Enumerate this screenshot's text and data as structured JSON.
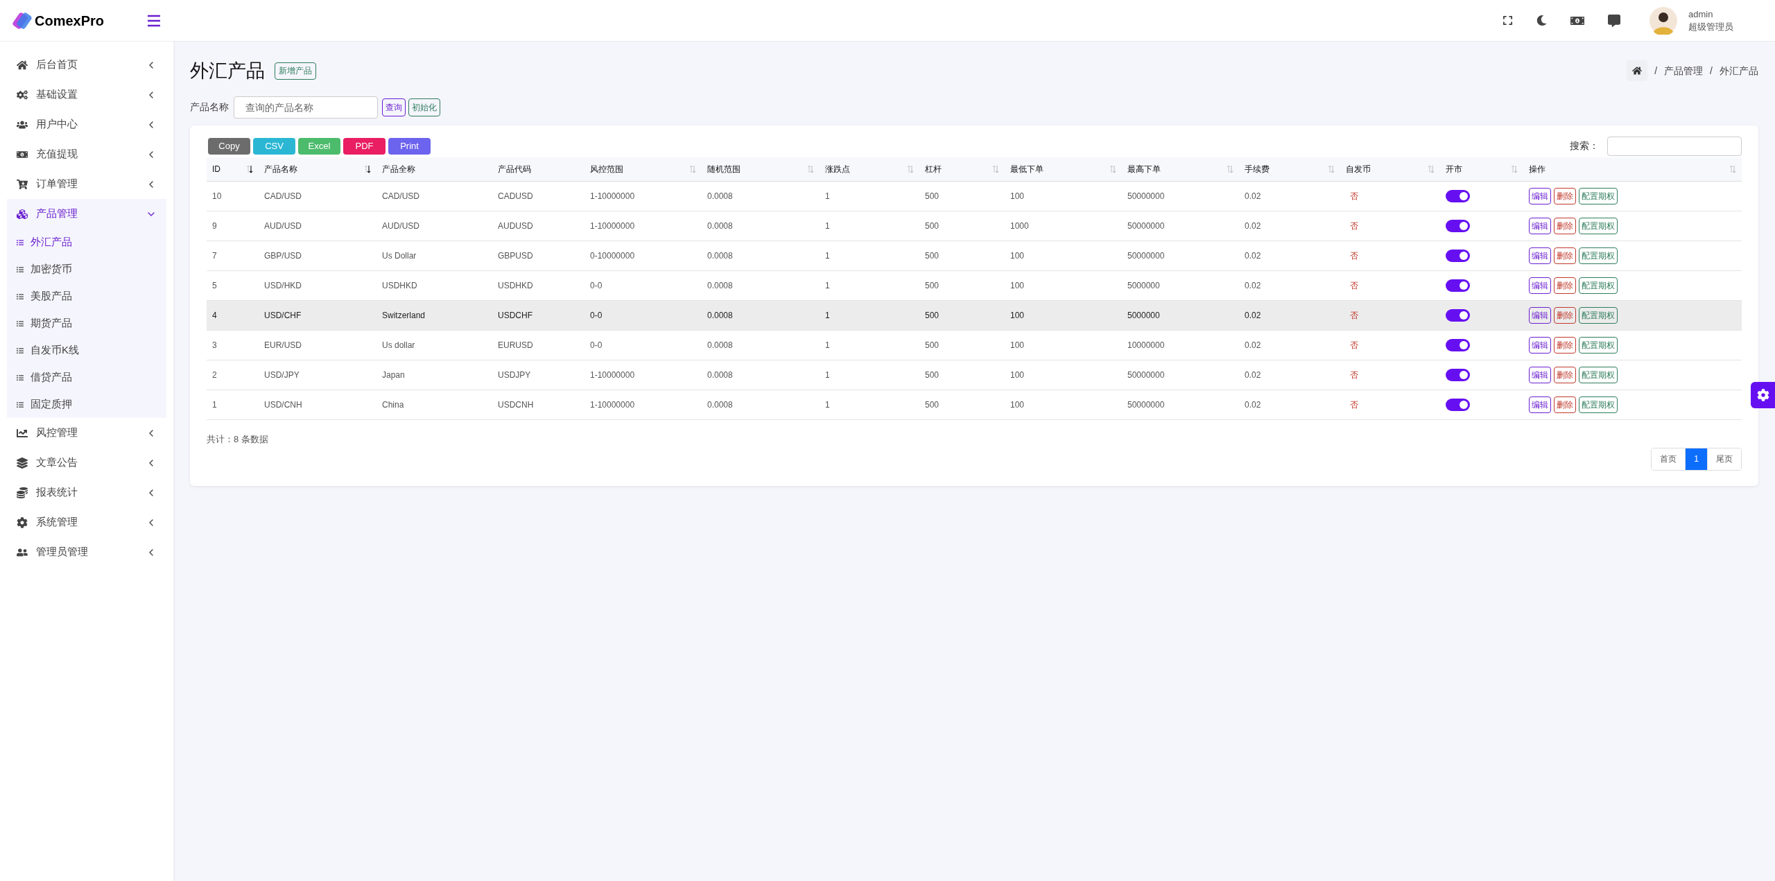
{
  "brand": {
    "name": "ComexPro"
  },
  "sidebar": {
    "items": [
      {
        "label": "后台首页",
        "expanded": false
      },
      {
        "label": "基础设置",
        "expanded": false
      },
      {
        "label": "用户中心",
        "expanded": false
      },
      {
        "label": "充值提现",
        "expanded": false
      },
      {
        "label": "订单管理",
        "expanded": false
      },
      {
        "label": "产品管理",
        "expanded": true,
        "children": [
          {
            "label": "外汇产品",
            "selected": true
          },
          {
            "label": "加密货币",
            "selected": false
          },
          {
            "label": "美股产品",
            "selected": false
          },
          {
            "label": "期货产品",
            "selected": false
          },
          {
            "label": "自发币K线",
            "selected": false
          },
          {
            "label": "借贷产品",
            "selected": false
          },
          {
            "label": "固定质押",
            "selected": false
          }
        ]
      },
      {
        "label": "风控管理",
        "expanded": false
      },
      {
        "label": "文章公告",
        "expanded": false
      },
      {
        "label": "报表统计",
        "expanded": false
      },
      {
        "label": "系统管理",
        "expanded": false
      },
      {
        "label": "管理员管理",
        "expanded": false
      }
    ]
  },
  "user": {
    "name": "admin",
    "role": "超级管理员"
  },
  "page": {
    "title": "外汇产品",
    "add_button": "新增产品",
    "breadcrumb": [
      {
        "separator": "/",
        "label": "产品管理"
      },
      {
        "separator": "/",
        "label": "外汇产品"
      }
    ]
  },
  "filter": {
    "label": "产品名称",
    "placeholder": "查询的产品名称",
    "search_button": "查询",
    "reset_button": "初始化"
  },
  "export_buttons": [
    {
      "label": "Copy",
      "color": "#6c6c6c"
    },
    {
      "label": "CSV",
      "color": "#2bb7d4"
    },
    {
      "label": "Excel",
      "color": "#4cbb6c"
    },
    {
      "label": "PDF",
      "color": "#e91e63"
    },
    {
      "label": "Print",
      "color": "#6c63ee"
    }
  ],
  "search": {
    "label": "搜索："
  },
  "table": {
    "columns": [
      {
        "label": "ID",
        "kind": "sorted"
      },
      {
        "label": "产品名称",
        "kind": "sorted"
      },
      {
        "label": "产品全称",
        "kind": "plain"
      },
      {
        "label": "产品代码",
        "kind": "plain"
      },
      {
        "label": "风控范围",
        "kind": "sortable"
      },
      {
        "label": "随机范围",
        "kind": "sortable"
      },
      {
        "label": "涨跌点",
        "kind": "sortable"
      },
      {
        "label": "杠杆",
        "kind": "sortable"
      },
      {
        "label": "最低下单",
        "kind": "sortable"
      },
      {
        "label": "最高下单",
        "kind": "sortable"
      },
      {
        "label": "手续费",
        "kind": "sortable"
      },
      {
        "label": "自发币",
        "kind": "sortable"
      },
      {
        "label": "开市",
        "kind": "sortable"
      },
      {
        "label": "操作",
        "kind": "sortable"
      }
    ],
    "rows": [
      {
        "cells": [
          "10",
          "CAD/USD",
          "CAD/USD",
          "CADUSD",
          "1-10000000",
          "0.0008",
          "1",
          "500",
          "100",
          "50000000",
          "0.02",
          "否"
        ],
        "open": true,
        "highlighted": false,
        "actions": [
          "编辑",
          "删除",
          "配置期权"
        ]
      },
      {
        "cells": [
          "9",
          "AUD/USD",
          "AUD/USD",
          "AUDUSD",
          "1-10000000",
          "0.0008",
          "1",
          "500",
          "1000",
          "50000000",
          "0.02",
          "否"
        ],
        "open": true,
        "highlighted": false,
        "actions": [
          "编辑",
          "删除",
          "配置期权"
        ]
      },
      {
        "cells": [
          "7",
          "GBP/USD",
          "Us Dollar",
          "GBPUSD",
          "0-10000000",
          "0.0008",
          "1",
          "500",
          "100",
          "50000000",
          "0.02",
          "否"
        ],
        "open": true,
        "highlighted": false,
        "actions": [
          "编辑",
          "删除",
          "配置期权"
        ]
      },
      {
        "cells": [
          "5",
          "USD/HKD",
          "USDHKD",
          "USDHKD",
          "0-0",
          "0.0008",
          "1",
          "500",
          "100",
          "5000000",
          "0.02",
          "否"
        ],
        "open": true,
        "highlighted": false,
        "actions": [
          "编辑",
          "删除",
          "配置期权"
        ]
      },
      {
        "cells": [
          "4",
          "USD/CHF",
          "Switzerland",
          "USDCHF",
          "0-0",
          "0.0008",
          "1",
          "500",
          "100",
          "5000000",
          "0.02",
          "否"
        ],
        "open": true,
        "highlighted": true,
        "actions": [
          "编辑",
          "删除",
          "配置期权"
        ]
      },
      {
        "cells": [
          "3",
          "EUR/USD",
          "Us dollar",
          "EURUSD",
          "0-0",
          "0.0008",
          "1",
          "500",
          "100",
          "10000000",
          "0.02",
          "否"
        ],
        "open": true,
        "highlighted": false,
        "actions": [
          "编辑",
          "删除",
          "配置期权"
        ]
      },
      {
        "cells": [
          "2",
          "USD/JPY",
          "Japan",
          "USDJPY",
          "1-10000000",
          "0.0008",
          "1",
          "500",
          "100",
          "50000000",
          "0.02",
          "否"
        ],
        "open": true,
        "highlighted": false,
        "actions": [
          "编辑",
          "删除",
          "配置期权"
        ]
      },
      {
        "cells": [
          "1",
          "USD/CNH",
          "China",
          "USDCNH",
          "1-10000000",
          "0.0008",
          "1",
          "500",
          "100",
          "50000000",
          "0.02",
          "否"
        ],
        "open": true,
        "highlighted": false,
        "actions": [
          "编辑",
          "删除",
          "配置期权"
        ]
      }
    ]
  },
  "total": "共计：8 条数据",
  "pagination": [
    {
      "label": "首页",
      "selected": false
    },
    {
      "label": "1",
      "selected": true
    },
    {
      "label": "尾页",
      "selected": false
    }
  ]
}
